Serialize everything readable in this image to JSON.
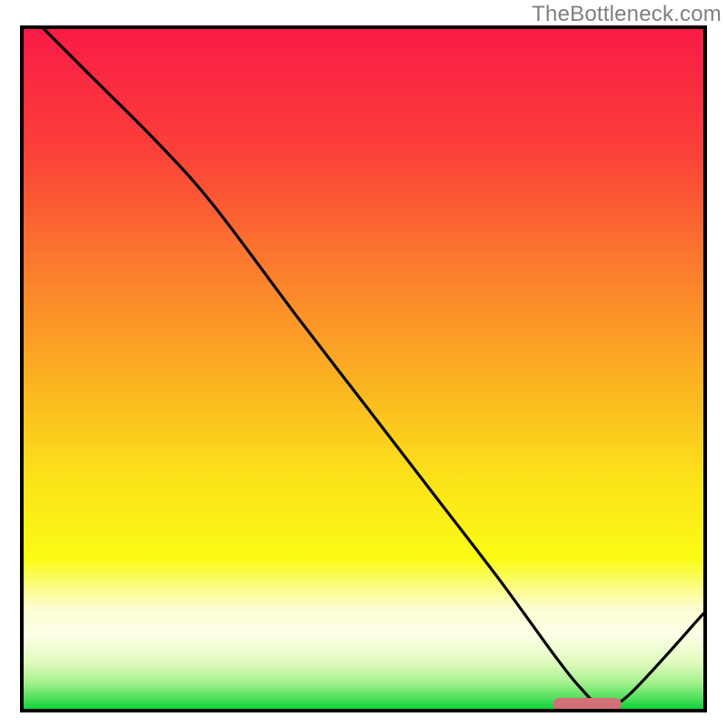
{
  "watermark": "TheBottleneck.com",
  "colors": {
    "border": "#000000",
    "curve": "#000000",
    "marker": "#d17077",
    "watermark_text": "#808080"
  },
  "chart_data": {
    "type": "line",
    "title": "",
    "xlabel": "",
    "ylabel": "",
    "xlim": [
      0,
      100
    ],
    "ylim": [
      0,
      100
    ],
    "x": [
      3,
      10,
      20,
      28,
      40,
      50,
      60,
      70,
      78,
      82,
      85,
      89,
      100
    ],
    "values": [
      100,
      93,
      83,
      74,
      58,
      45,
      32,
      19,
      8,
      3,
      0.5,
      2,
      14
    ],
    "trough_marker": {
      "x_start": 78,
      "x_end": 88,
      "y": 0.7
    },
    "gradient_stops": [
      {
        "offset": 0,
        "color": "#fa1b46"
      },
      {
        "offset": 18,
        "color": "#fb4039"
      },
      {
        "offset": 35,
        "color": "#fb7c2d"
      },
      {
        "offset": 52,
        "color": "#fbb321"
      },
      {
        "offset": 66,
        "color": "#fbe219"
      },
      {
        "offset": 78,
        "color": "#fbfb15"
      },
      {
        "offset": 85,
        "color": "#fbfdce"
      },
      {
        "offset": 89,
        "color": "#fdffe6"
      },
      {
        "offset": 93,
        "color": "#e2fbc0"
      },
      {
        "offset": 96,
        "color": "#a9f291"
      },
      {
        "offset": 98.5,
        "color": "#4fdf5b"
      },
      {
        "offset": 100,
        "color": "#0fd13a"
      }
    ]
  }
}
